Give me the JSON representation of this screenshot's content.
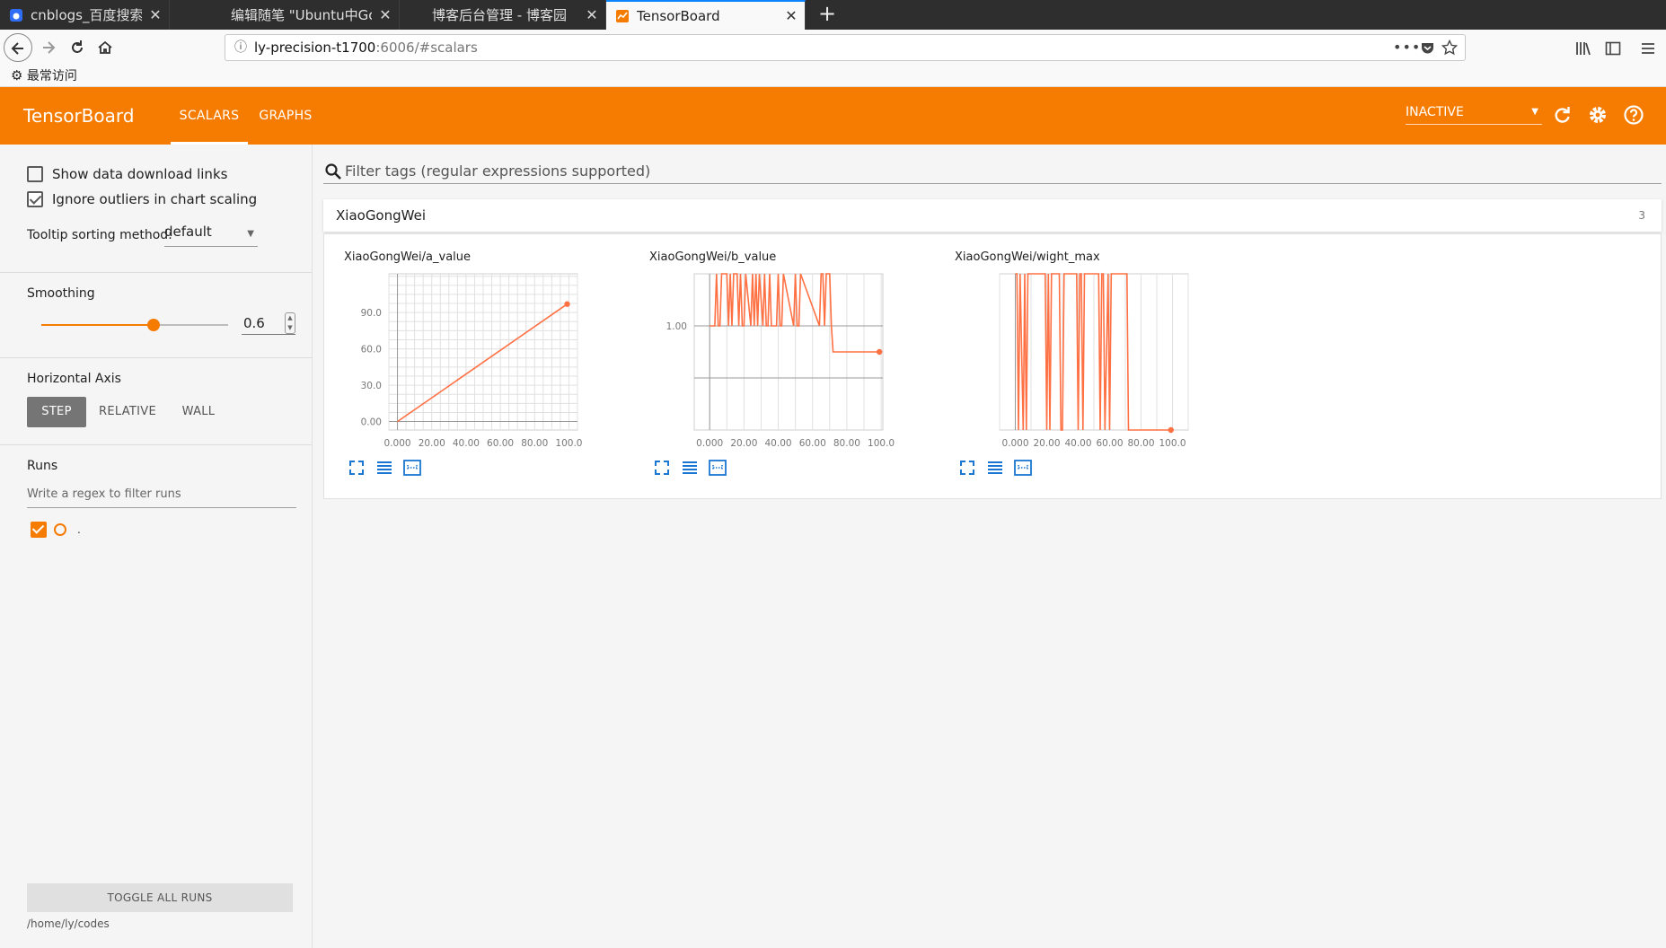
{
  "browser": {
    "tabs": [
      {
        "title": "cnblogs_百度搜索",
        "active": false
      },
      {
        "title": "编辑随笔 \"Ubuntu中Goo",
        "active": false
      },
      {
        "title": "博客后台管理 - 博客园",
        "active": false
      },
      {
        "title": "TensorBoard",
        "active": true
      }
    ],
    "new_tab": "+",
    "url_host": "ly-precision-t1700",
    "url_rest": ":6006/#scalars",
    "bookmarks_label": "最常访问"
  },
  "header": {
    "logo": "TensorBoard",
    "tabs": [
      "SCALARS",
      "GRAPHS"
    ],
    "status": "INACTIVE"
  },
  "sidebar": {
    "show_download_links": "Show data download links",
    "ignore_outliers": "Ignore outliers in chart scaling",
    "tooltip_label": "Tooltip sorting method:",
    "tooltip_value": "default",
    "smoothing_label": "Smoothing",
    "smoothing_value": "0.6",
    "smoothing_fraction": 0.6,
    "axis_label": "Horizontal Axis",
    "axis_options": [
      "STEP",
      "RELATIVE",
      "WALL"
    ],
    "runs_label": "Runs",
    "runs_filter_placeholder": "Write a regex to filter runs",
    "run_name": ".",
    "toggle_all": "TOGGLE ALL RUNS",
    "logdir": "/home/ly/codes"
  },
  "main": {
    "filter_placeholder": "Filter tags (regular expressions supported)",
    "category": "XiaoGongWei",
    "category_count": "3"
  },
  "colors": {
    "accent": "#f57c00",
    "series": "#ff7043"
  },
  "chart_data": [
    {
      "type": "line",
      "title": "XiaoGongWei/a_value",
      "x_ticks": [
        "0.000",
        "20.00",
        "40.00",
        "60.00",
        "80.00",
        "100.0"
      ],
      "y_ticks": [
        "0.00",
        "30.0",
        "60.0",
        "90.0"
      ],
      "xlim": [
        -5,
        105
      ],
      "ylim": [
        -7,
        122
      ],
      "grid": "dense",
      "series": [
        {
          "x": [
            0,
            99
          ],
          "y": [
            0,
            97
          ]
        }
      ]
    },
    {
      "type": "line",
      "title": "XiaoGongWei/b_value",
      "x_ticks": [
        "0.000",
        "20.00",
        "40.00",
        "60.00",
        "80.00",
        "100.0"
      ],
      "y_ticks": [
        "1.00"
      ],
      "xlim": [
        -9,
        101
      ],
      "ylim": [
        -1,
        2
      ],
      "grid": "vertical",
      "series": [
        {
          "x": [
            0,
            3,
            4,
            5,
            6,
            7,
            10,
            11,
            12,
            13,
            14,
            16,
            17,
            18,
            19,
            20,
            21,
            24,
            25,
            26,
            27,
            28,
            29,
            31,
            32,
            33,
            34,
            35,
            36,
            39,
            40,
            41,
            42,
            43,
            49,
            50,
            51,
            52,
            53,
            64,
            65,
            66,
            67,
            68,
            70,
            71,
            72,
            73,
            99
          ],
          "y": [
            1,
            1,
            2,
            1,
            1,
            2,
            2,
            1,
            2,
            1,
            2,
            2,
            1,
            2,
            1,
            1,
            2,
            1,
            2,
            1,
            2,
            1,
            2,
            1,
            2,
            1,
            1,
            2,
            1,
            1,
            2,
            1,
            1,
            2,
            1,
            2,
            1,
            1,
            2,
            1,
            2,
            2,
            1,
            2,
            2,
            1,
            0.5,
            0.5,
            0.5
          ]
        }
      ]
    },
    {
      "type": "line",
      "title": "XiaoGongWei/wight_max",
      "x_ticks": [
        "0.000",
        "20.00",
        "40.00",
        "60.00",
        "80.00",
        "100.0"
      ],
      "y_ticks": [],
      "xlim": [
        -10,
        110
      ],
      "ylim": [
        0,
        1
      ],
      "grid": "vertical",
      "series": [
        {
          "x": [
            0,
            1,
            2,
            3,
            5,
            6,
            7,
            8,
            19,
            20,
            21,
            22,
            23,
            24,
            28,
            29,
            30,
            31,
            39,
            40,
            41,
            42,
            43,
            44,
            53,
            54,
            55,
            56,
            57,
            59,
            60,
            61,
            71,
            72,
            73,
            98,
            99
          ],
          "y": [
            1,
            1,
            0,
            1,
            0,
            1,
            0,
            1,
            1,
            0,
            1,
            0,
            1,
            1,
            1,
            0,
            0,
            1,
            1,
            0,
            1,
            1,
            0,
            1,
            1,
            0,
            1,
            1,
            0,
            1,
            0,
            1,
            1,
            0,
            0,
            0,
            0
          ]
        }
      ]
    }
  ]
}
